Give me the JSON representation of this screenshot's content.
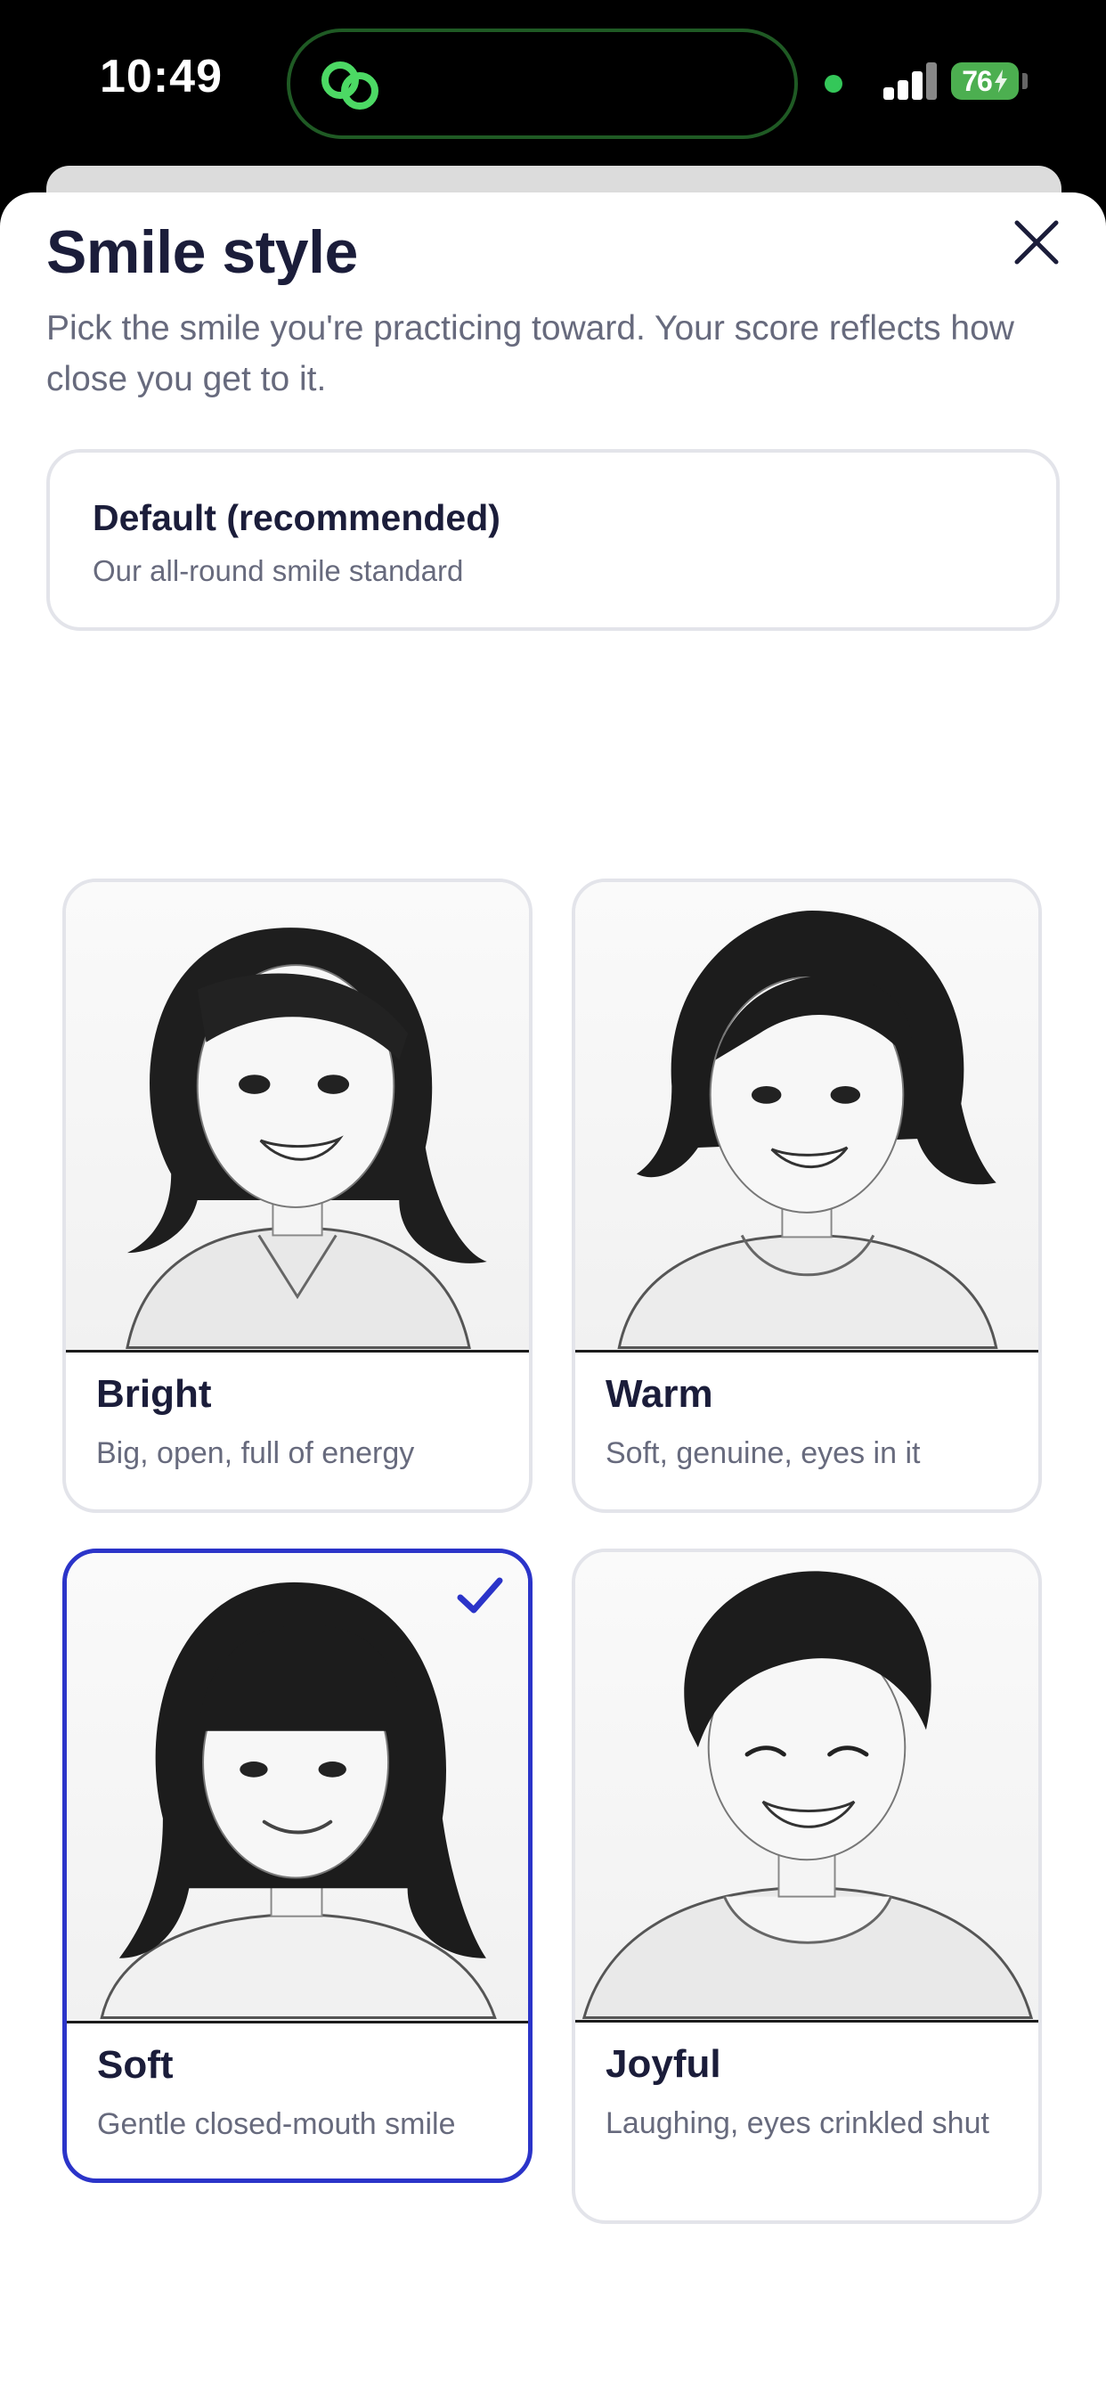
{
  "status_bar": {
    "time": "10:49",
    "battery": "76"
  },
  "sheet": {
    "title": "Smile style",
    "subtitle": "Pick the smile you're practicing toward. Your score reflects how close you get to it.",
    "default_option": {
      "title": "Default (recommended)",
      "description": "Our all-round smile standard"
    },
    "options": [
      {
        "title": "Bright",
        "description": "Big, open, full of energy",
        "selected": false
      },
      {
        "title": "Warm",
        "description": "Soft, genuine, eyes in it",
        "selected": false
      },
      {
        "title": "Soft",
        "description": "Gentle closed-mouth smile",
        "selected": true
      },
      {
        "title": "Joyful",
        "description": "Laughing, eyes crinkled shut",
        "selected": false
      }
    ]
  },
  "colors": {
    "accent": "#2b34c9",
    "title": "#1b1d3a",
    "muted": "#676a7d",
    "card_border": "#e3e4ea",
    "battery": "#4caf50",
    "island_ring": "#1f5a24"
  },
  "icons": [
    "link-icon",
    "signal-icon",
    "battery-icon",
    "close-icon",
    "checkmark-icon"
  ]
}
